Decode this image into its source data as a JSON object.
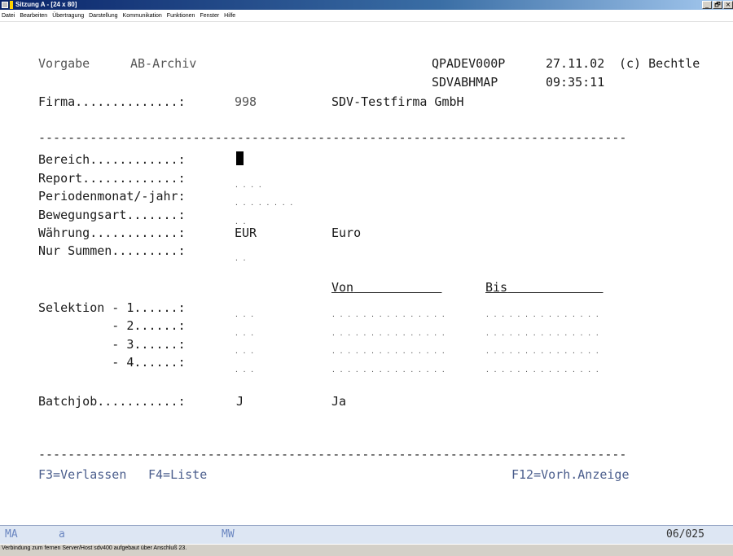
{
  "window": {
    "title": "Sitzung A - [24 x 80]",
    "buttons": [
      "_",
      "🗗",
      "×"
    ]
  },
  "menubar": [
    "Datei",
    "Bearbeiten",
    "Übertragung",
    "Darstellung",
    "Kommunikation",
    "Funktionen",
    "Fenster",
    "Hilfe"
  ],
  "header": {
    "vorgabe": "Vorgabe",
    "archiv": "AB-Archiv",
    "program": "QPADEV000P",
    "date": "27.11.02",
    "copyright": "(c) Bechtle",
    "map": "SDVABHMAP",
    "time": "09:35:11",
    "firma_label": "Firma..............:",
    "firma_no": "998",
    "firma_name": "SDV-Testfirma GmbH"
  },
  "separator": "--------------------------------------------------------------------------------",
  "form": {
    "bereich_label": "Bereich............:",
    "report_label": "Report.............:",
    "periode_label": "Periodenmonat/-jahr:",
    "bewegung_label": "Bewegungsart.......:",
    "waehrung_label": "Währung............:",
    "waehrung_value": "EUR",
    "waehrung_text": "Euro",
    "summen_label": "Nur Summen.........:",
    "von_header": "Von",
    "bis_header": "Bis",
    "selektion": [
      "Selektion - 1......:",
      "          - 2......:",
      "          - 3......:",
      "          - 4......:"
    ],
    "batch_label": "Batchjob...........:",
    "batch_value": "J",
    "batch_text": "Ja"
  },
  "fkeys": {
    "f3": "F3=Verlassen",
    "f4": "F4=Liste",
    "f12": "F12=Vorh.Anzeige"
  },
  "status": {
    "ma": "MA",
    "a": "a",
    "mw": "MW",
    "pos": "06/025"
  },
  "connection": "Verbindung zum fernen Server/Host sdv400 aufgebaut über Anschluß 23."
}
